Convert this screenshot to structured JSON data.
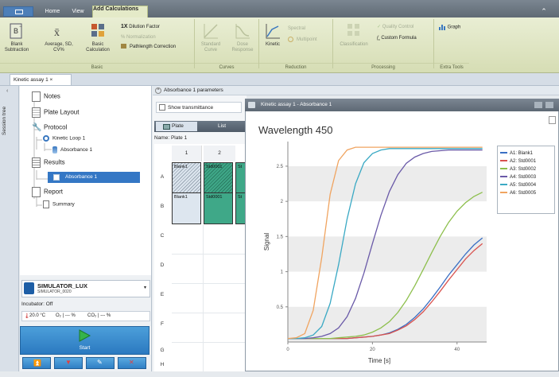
{
  "ribbon_tabs": {
    "home": "Home",
    "view": "View",
    "active": "Add Calculations"
  },
  "ribbon": {
    "blank_subtraction": [
      "Blank",
      "Subtraction"
    ],
    "average": [
      "Average, SD,",
      "CV%"
    ],
    "basic_calculation": [
      "Basic",
      "Calculation"
    ],
    "dilution_factor": "Dilution Factor",
    "normalization": "% Normalization",
    "pathlength_correction": "Pathlength Correction",
    "standard_curve": [
      "Standard",
      "Curve"
    ],
    "dose_response": [
      "Dose",
      "Response"
    ],
    "kinetic": "Kinetic",
    "spectral": "Spectral",
    "multipoint": "Multipoint",
    "classification": "Classification",
    "quality_control": "Quality Control",
    "custom_formula": "Custom Formula",
    "graph": "Graph",
    "groups": {
      "basic": "Basic",
      "curves": "Curves",
      "reduction": "Reduction",
      "processing": "Processing",
      "extra": "Extra Tools"
    }
  },
  "doc_tab": "Kinetic assay 1",
  "session_tree_label": "Session tree",
  "tree": {
    "notes": "Notes",
    "plate_layout": "Plate Layout",
    "protocol": "Protocol",
    "kinetic_loop": "Kinetic Loop 1",
    "absorbance_protocol": "Absorbance 1",
    "results": "Results",
    "absorbance_result": "Absorbance 1",
    "report": "Report",
    "summary": "Summary"
  },
  "instrument": {
    "name": "SIMULATOR_LUX",
    "serial": "SIMULATOR_0020",
    "incubator": "Incubator: Off",
    "temperature": "20.0 °C",
    "o2": "O₂ | --- %",
    "co2": "CO₂ | --- %",
    "start": "Start"
  },
  "plate": {
    "params_header": "Absorbance 1 parameters",
    "show_transmittance": "Show transmittance",
    "tab_plate": "Plate",
    "tab_list": "List",
    "name_label": "Name: Plate 1",
    "columns": [
      "1",
      "2"
    ],
    "rows": [
      "A",
      "B",
      "C",
      "D",
      "E",
      "F",
      "G",
      "H"
    ],
    "row_a": [
      "Blank1",
      "Std0001",
      "St"
    ],
    "row_b": [
      "Blank1",
      "Std0001",
      "St"
    ]
  },
  "chart_window_title": "Kinetic assay 1 - Absorbance 1",
  "chart_data": {
    "type": "line",
    "title": "Wavelength 450",
    "xlabel": "Time [s]",
    "ylabel": "Signal",
    "xlim": [
      0,
      47
    ],
    "ylim": [
      0,
      2.85
    ],
    "xticks": [
      0,
      20,
      40
    ],
    "yticks": [
      0.5,
      1,
      1.5,
      2,
      2.5
    ],
    "grid": "horizontal bands",
    "legend_position": "top-right",
    "x": [
      0,
      2,
      4,
      6,
      8,
      10,
      12,
      14,
      16,
      18,
      20,
      22,
      24,
      26,
      28,
      30,
      32,
      34,
      36,
      38,
      40,
      42,
      44,
      46
    ],
    "series": [
      {
        "name": "A1: Blank1",
        "color": "#3a6fc4",
        "values": [
          0.05,
          0.05,
          0.05,
          0.05,
          0.05,
          0.05,
          0.05,
          0.05,
          0.06,
          0.07,
          0.08,
          0.1,
          0.13,
          0.18,
          0.25,
          0.35,
          0.47,
          0.62,
          0.78,
          0.95,
          1.1,
          1.25,
          1.38,
          1.48
        ]
      },
      {
        "name": "A2: Std0001",
        "color": "#d9534f",
        "values": [
          0.05,
          0.05,
          0.05,
          0.05,
          0.05,
          0.05,
          0.05,
          0.05,
          0.06,
          0.07,
          0.08,
          0.1,
          0.12,
          0.17,
          0.23,
          0.32,
          0.43,
          0.57,
          0.72,
          0.88,
          1.03,
          1.18,
          1.3,
          1.4
        ]
      },
      {
        "name": "A3: Std0002",
        "color": "#8dbf4c",
        "values": [
          0.05,
          0.05,
          0.05,
          0.05,
          0.05,
          0.05,
          0.06,
          0.07,
          0.08,
          0.1,
          0.14,
          0.2,
          0.29,
          0.42,
          0.59,
          0.8,
          1.03,
          1.27,
          1.5,
          1.7,
          1.86,
          1.98,
          2.07,
          2.13
        ]
      },
      {
        "name": "A4: Std0003",
        "color": "#6a5aa8",
        "values": [
          0.05,
          0.05,
          0.05,
          0.06,
          0.08,
          0.12,
          0.2,
          0.36,
          0.62,
          0.98,
          1.4,
          1.8,
          2.14,
          2.38,
          2.54,
          2.63,
          2.68,
          2.71,
          2.72,
          2.73,
          2.73,
          2.73,
          2.73,
          2.73
        ]
      },
      {
        "name": "A5: Std0004",
        "color": "#3aa9c4",
        "values": [
          0.05,
          0.05,
          0.06,
          0.1,
          0.22,
          0.55,
          1.1,
          1.75,
          2.25,
          2.55,
          2.68,
          2.73,
          2.75,
          2.75,
          2.75,
          2.75,
          2.75,
          2.75,
          2.75,
          2.75,
          2.75,
          2.75,
          2.75,
          2.75
        ]
      },
      {
        "name": "A6: Std0005",
        "color": "#f0a460",
        "values": [
          0.05,
          0.06,
          0.12,
          0.45,
          1.2,
          2.1,
          2.58,
          2.73,
          2.77,
          2.77,
          2.77,
          2.77,
          2.77,
          2.77,
          2.77,
          2.77,
          2.77,
          2.77,
          2.77,
          2.77,
          2.77,
          2.77,
          2.77,
          2.77
        ]
      }
    ]
  },
  "icons": {
    "start": "play-icon",
    "arrow_up": "move-up-icon",
    "arrow_down": "move-down-icon",
    "edit": "pencil-icon",
    "delete": "delete-icon"
  }
}
